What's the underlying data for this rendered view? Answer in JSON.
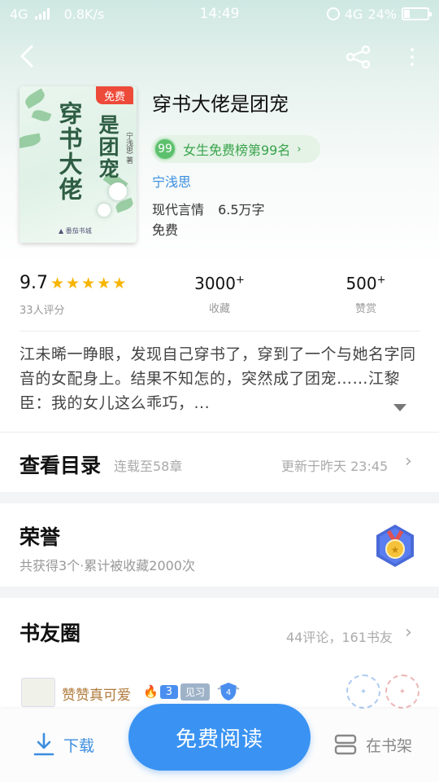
{
  "status_bar": {
    "network": "4G",
    "speed": "0.8K/s",
    "time": "14:49",
    "network_right": "4G",
    "battery": "24%",
    "battery_level": 0.24
  },
  "book": {
    "cover_free_badge": "免费",
    "cover_title_1": "穿书大佬",
    "cover_title_2": "是团宠",
    "cover_author": "宁浅思 著",
    "title": "穿书大佬是团宠",
    "rank_number": "99",
    "rank_text": "女生免费榜第99名",
    "rank_chevron": "›",
    "author": "宁浅思",
    "genre": "现代言情",
    "word_count": "6.5万字",
    "price": "免费"
  },
  "stats": {
    "rating": "9.7",
    "stars": 5,
    "rating_count": "33人评分",
    "favorites_value": "3000",
    "favorites_plus": "+",
    "favorites_label": "收藏",
    "reward_value": "500",
    "reward_plus": "+",
    "reward_label": "赞赏"
  },
  "summary": "江未晞一睁眼，发现自己穿书了，穿到了一个与她名字同音的女配身上。结果不知怎的，突然成了团宠……江黎臣：我的女儿这么乖巧，...",
  "catalog": {
    "title": "查看目录",
    "status": "连载至58章",
    "update": "更新于昨天 23:45"
  },
  "honor": {
    "title": "荣誉",
    "subtitle": "共获得3个·累计被收藏2000次"
  },
  "circle": {
    "title": "书友圈",
    "stats": "44评论，161书友",
    "comment_user": "赞赞真可爱",
    "vip_level": "3",
    "level_tag": "见习",
    "shield_level": "4"
  },
  "bottom_bar": {
    "download": "下载",
    "read": "免费阅读",
    "shelf": "在书架"
  },
  "colors": {
    "accent_blue": "#3a93f2",
    "rank_green": "#3aa34c",
    "star_yellow": "#f7b500",
    "free_red": "#ee4a3a"
  }
}
